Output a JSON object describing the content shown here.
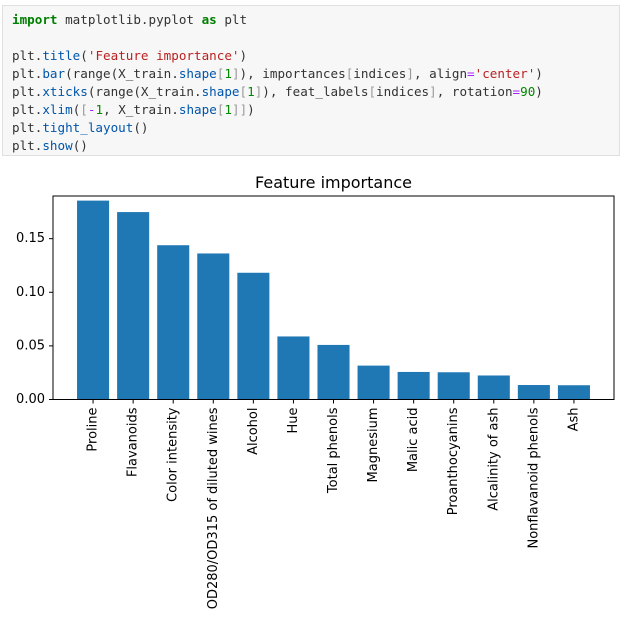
{
  "code_cell": {
    "lines": [
      [
        {
          "t": "import",
          "c": "kw"
        },
        {
          "t": " matplotlib.pyplot ",
          "c": ""
        },
        {
          "t": "as",
          "c": "kw"
        },
        {
          "t": " plt",
          "c": ""
        }
      ],
      [],
      [
        {
          "t": "plt.",
          "c": ""
        },
        {
          "t": "title",
          "c": "fn"
        },
        {
          "t": "(",
          "c": ""
        },
        {
          "t": "'Feature importance'",
          "c": "str"
        },
        {
          "t": ")",
          "c": ""
        }
      ],
      [
        {
          "t": "plt.",
          "c": ""
        },
        {
          "t": "bar",
          "c": "fn"
        },
        {
          "t": "(range(X_train.",
          "c": ""
        },
        {
          "t": "shape",
          "c": "fn"
        },
        {
          "t": "[",
          "c": "br"
        },
        {
          "t": "1",
          "c": "num"
        },
        {
          "t": "]",
          "c": "br"
        },
        {
          "t": "), importances",
          "c": ""
        },
        {
          "t": "[",
          "c": "br"
        },
        {
          "t": "indices",
          "c": ""
        },
        {
          "t": "]",
          "c": "br"
        },
        {
          "t": ", align",
          "c": ""
        },
        {
          "t": "=",
          "c": "op"
        },
        {
          "t": "'center'",
          "c": "str"
        },
        {
          "t": ")",
          "c": ""
        }
      ],
      [
        {
          "t": "plt.",
          "c": ""
        },
        {
          "t": "xticks",
          "c": "fn"
        },
        {
          "t": "(range(X_train.",
          "c": ""
        },
        {
          "t": "shape",
          "c": "fn"
        },
        {
          "t": "[",
          "c": "br"
        },
        {
          "t": "1",
          "c": "num"
        },
        {
          "t": "]",
          "c": "br"
        },
        {
          "t": "), feat_labels",
          "c": ""
        },
        {
          "t": "[",
          "c": "br"
        },
        {
          "t": "indices",
          "c": ""
        },
        {
          "t": "]",
          "c": "br"
        },
        {
          "t": ", rotation",
          "c": ""
        },
        {
          "t": "=",
          "c": "op"
        },
        {
          "t": "90",
          "c": "num"
        },
        {
          "t": ")",
          "c": ""
        }
      ],
      [
        {
          "t": "plt.",
          "c": ""
        },
        {
          "t": "xlim",
          "c": "fn"
        },
        {
          "t": "(",
          "c": ""
        },
        {
          "t": "[",
          "c": "br"
        },
        {
          "t": "-",
          "c": "op"
        },
        {
          "t": "1",
          "c": "num"
        },
        {
          "t": ", X_train.",
          "c": ""
        },
        {
          "t": "shape",
          "c": "fn"
        },
        {
          "t": "[",
          "c": "br"
        },
        {
          "t": "1",
          "c": "num"
        },
        {
          "t": "]]",
          "c": "br"
        },
        {
          "t": ")",
          "c": ""
        }
      ],
      [
        {
          "t": "plt.",
          "c": ""
        },
        {
          "t": "tight_layout",
          "c": "fn"
        },
        {
          "t": "()",
          "c": ""
        }
      ],
      [
        {
          "t": "plt.",
          "c": ""
        },
        {
          "t": "show",
          "c": "fn"
        },
        {
          "t": "()",
          "c": ""
        }
      ]
    ]
  },
  "chart_data": {
    "type": "bar",
    "title": "Feature importance",
    "xlabel": "",
    "ylabel": "",
    "categories": [
      "Proline",
      "Flavanoids",
      "Color intensity",
      "OD280/OD315 of diluted wines",
      "Alcohol",
      "Hue",
      "Total phenols",
      "Magnesium",
      "Malic acid",
      "Proanthocyanins",
      "Alcalinity of ash",
      "Nonflavanoid phenols",
      "Ash"
    ],
    "values": [
      0.1855,
      0.1748,
      0.1439,
      0.1362,
      0.1182,
      0.0588,
      0.0509,
      0.0316,
      0.0257,
      0.0254,
      0.0224,
      0.0135,
      0.0133
    ],
    "xlim": [
      -1,
      13
    ],
    "ylim": [
      0,
      0.1898
    ],
    "yticks": [
      0.0,
      0.05,
      0.1,
      0.15
    ],
    "ytick_labels": [
      "0.00",
      "0.05",
      "0.10",
      "0.15"
    ],
    "xtick_rotation": 90,
    "bar_color": "#1f77b4",
    "grid": false,
    "legend": "none"
  }
}
